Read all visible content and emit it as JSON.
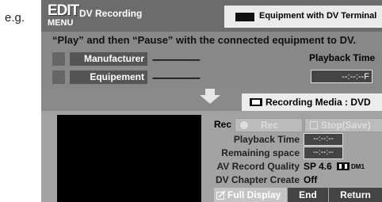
{
  "example_label": "e.g.",
  "header": {
    "logo_top": "EDIT",
    "logo_bottom": "MENU",
    "title": "DV Recording",
    "equipment_label": "Equipment with DV Terminal"
  },
  "instruction": "“Play” and then “Pause” with the connected equipment to DV.",
  "fields": {
    "manufacturer_label": "Manufacturer",
    "manufacturer_value": "--------------------",
    "equipment_label": "Equipement",
    "equipment_value": "--------------------"
  },
  "playback": {
    "title": "Playback Time",
    "value": "--:--:--F"
  },
  "media": {
    "label": "Recording Media : DVD"
  },
  "controls": {
    "rec_label": "Rec",
    "rec_button": "Rec",
    "stop_button": "Stop(Save)"
  },
  "info": {
    "playback_time_label": "Playback Time",
    "playback_time_value": "--:--:--",
    "remaining_label": "Remaining space",
    "remaining_value": "--:--:--",
    "quality_label": "AV Record Quality",
    "quality_value": "SP 4.6",
    "quality_badge": "DM1",
    "chapter_label": "DV Chapter Create",
    "chapter_value": "Off"
  },
  "footer": {
    "full_display": "Full Display",
    "end": "End",
    "return": "Return"
  }
}
